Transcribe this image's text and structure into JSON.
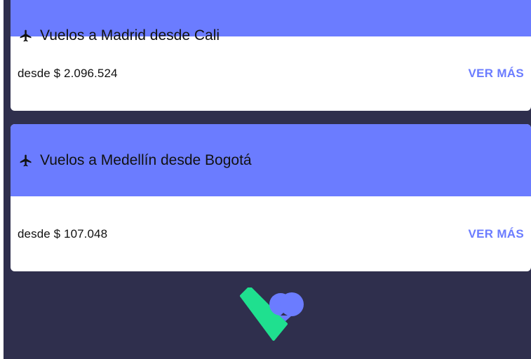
{
  "cards": [
    {
      "title": "Vuelos a Madrid desde Cali",
      "price": "desde $ 2.096.524",
      "more_label": "VER MÁS"
    },
    {
      "title": "Vuelos a Medellín desde Bogotá",
      "price": "desde $ 107.048",
      "more_label": "VER MÁS"
    }
  ],
  "colors": {
    "header": "#6b7cff",
    "background": "#2f2f4d",
    "logo_green": "#1fe08f",
    "logo_blue": "#6b7cff"
  },
  "icons": {
    "plane": "airplane-icon",
    "logo": "brand-logo"
  }
}
